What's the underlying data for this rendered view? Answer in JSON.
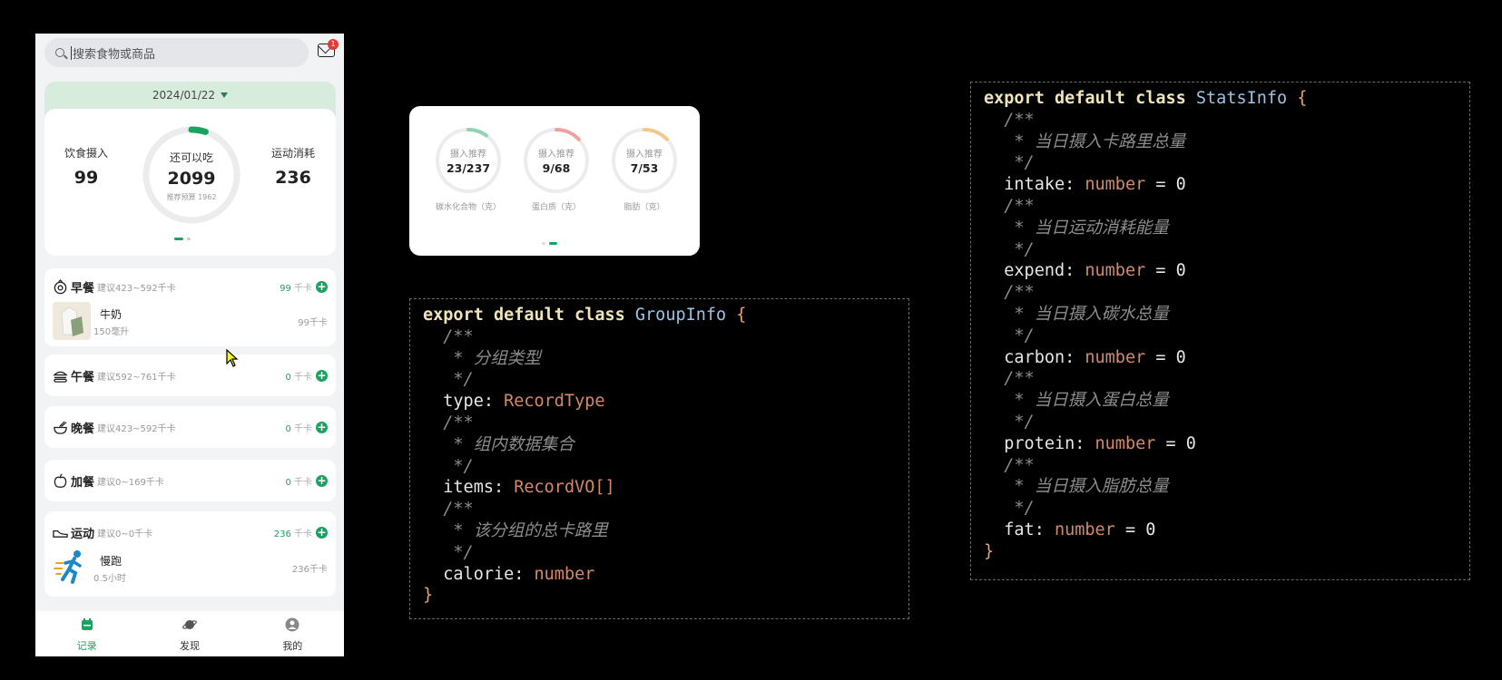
{
  "phone": {
    "search": {
      "placeholder": "搜索食物或商品",
      "badge": "1"
    },
    "stats": {
      "date": "2024/01/22",
      "intake_label": "饮食摄入",
      "intake_value": "99",
      "remaining_label": "还可以吃",
      "remaining_value": "2099",
      "budget_label": "推荐预算 1962",
      "expend_label": "运动消耗",
      "expend_value": "236",
      "ring_progress": 0.05
    },
    "meals": [
      {
        "name": "早餐",
        "suggestion": "建议423~592千卡",
        "kcal": "99",
        "unit": " 千卡",
        "items": [
          {
            "name": "牛奶",
            "amount": "150毫升",
            "kcal": "99千卡"
          }
        ]
      },
      {
        "name": "午餐",
        "suggestion": "建议592~761千卡",
        "kcal": "0",
        "unit": " 千卡",
        "items": []
      },
      {
        "name": "晚餐",
        "suggestion": "建议423~592千卡",
        "kcal": "0",
        "unit": " 千卡",
        "items": []
      },
      {
        "name": "加餐",
        "suggestion": "建议0~169千卡",
        "kcal": "0",
        "unit": " 千卡",
        "items": []
      },
      {
        "name": "运动",
        "suggestion": "建议0~0千卡",
        "kcal": "236",
        "unit": " 千卡",
        "items": [
          {
            "name": "慢跑",
            "amount": "0.5小时",
            "kcal": "236千卡"
          }
        ]
      }
    ],
    "tabs": [
      {
        "label": "记录",
        "icon": "calendar-icon",
        "active": true
      },
      {
        "label": "发现",
        "icon": "planet-icon",
        "active": false
      },
      {
        "label": "我的",
        "icon": "user-icon",
        "active": false
      }
    ]
  },
  "nutrition": [
    {
      "top": "摄入推荐",
      "value": "23/237",
      "name": "碳水化合物（克）",
      "color": "#8fd3b4",
      "progress": 0.1
    },
    {
      "top": "摄入推荐",
      "value": "9/68",
      "name": "蛋白质（克）",
      "color": "#f0a0a0",
      "progress": 0.13
    },
    {
      "top": "摄入推荐",
      "value": "7/53",
      "name": "脂肪（克）",
      "color": "#f3c98a",
      "progress": 0.13
    }
  ],
  "code": {
    "group_info": [
      "export default class GroupInfo {",
      "/**",
      "* 分组类型",
      "*/",
      "type: RecordType",
      "/**",
      "* 组内数据集合",
      "*/",
      "items: RecordVO[]",
      "/**",
      "* 该分组的总卡路里",
      "*/",
      "calorie: number",
      "}"
    ],
    "stats_info": [
      "export default class StatsInfo {",
      "/**",
      "* 当日摄入卡路里总量",
      "*/",
      "intake: number = 0",
      "/**",
      "* 当日运动消耗能量",
      "*/",
      "expend: number = 0",
      "/**",
      "* 当日摄入碳水总量",
      "*/",
      "carbon: number = 0",
      "/**",
      "* 当日摄入蛋白总量",
      "*/",
      "protein: number = 0",
      "/**",
      "* 当日摄入脂肪总量",
      "*/",
      "fat: number = 0",
      "}"
    ]
  }
}
